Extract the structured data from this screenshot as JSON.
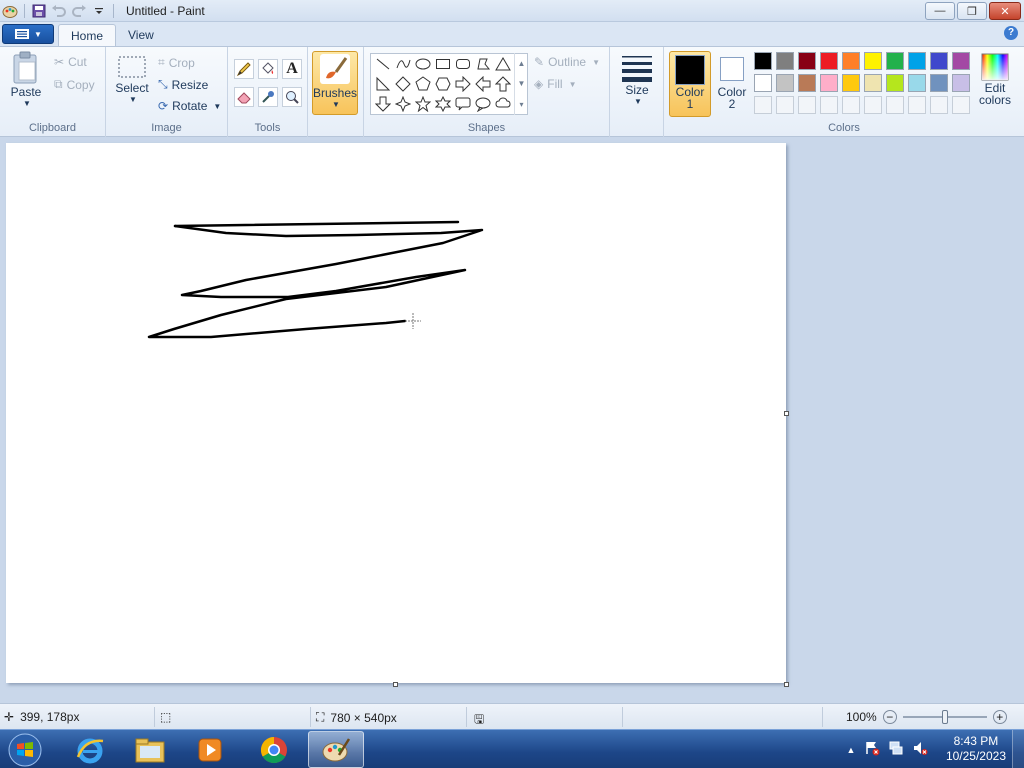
{
  "window": {
    "title": "Untitled - Paint",
    "controls": {
      "minimize": "—",
      "maximize": "❐",
      "close": "✕"
    }
  },
  "tabs": [
    {
      "label": "Home",
      "active": true
    },
    {
      "label": "View",
      "active": false
    }
  ],
  "ribbon": {
    "clipboard": {
      "label": "Clipboard",
      "paste": "Paste",
      "cut": "Cut",
      "copy": "Copy"
    },
    "image": {
      "label": "Image",
      "select": "Select",
      "crop": "Crop",
      "resize": "Resize",
      "rotate": "Rotate"
    },
    "tools": {
      "label": "Tools"
    },
    "brushes": {
      "label": "Brushes"
    },
    "shapes": {
      "label": "Shapes",
      "outline": "Outline",
      "fill": "Fill"
    },
    "size": {
      "label": "Size"
    },
    "colors": {
      "label": "Colors",
      "color1": {
        "line1": "Color",
        "line2": "1",
        "value": "#000000"
      },
      "color2": {
        "line1": "Color",
        "line2": "2",
        "value": "#ffffff"
      },
      "edit": {
        "line1": "Edit",
        "line2": "colors"
      },
      "palette_row1": [
        "#000000",
        "#7f7f7f",
        "#880015",
        "#ed1c24",
        "#ff7f27",
        "#fff200",
        "#22b14c",
        "#00a2e8",
        "#3f48cc",
        "#a349a4"
      ],
      "palette_row2": [
        "#ffffff",
        "#c3c3c3",
        "#b97a57",
        "#ffaec9",
        "#ffc90e",
        "#efe4b0",
        "#b5e61d",
        "#99d9ea",
        "#7092be",
        "#c8bfe7"
      ]
    }
  },
  "status": {
    "cursor_pos": "399, 178px",
    "selection_size": "",
    "canvas_size": "780 × 540px",
    "zoom": "100%"
  },
  "taskbar": {
    "time": "8:43 PM",
    "date": "10/25/2023"
  }
}
